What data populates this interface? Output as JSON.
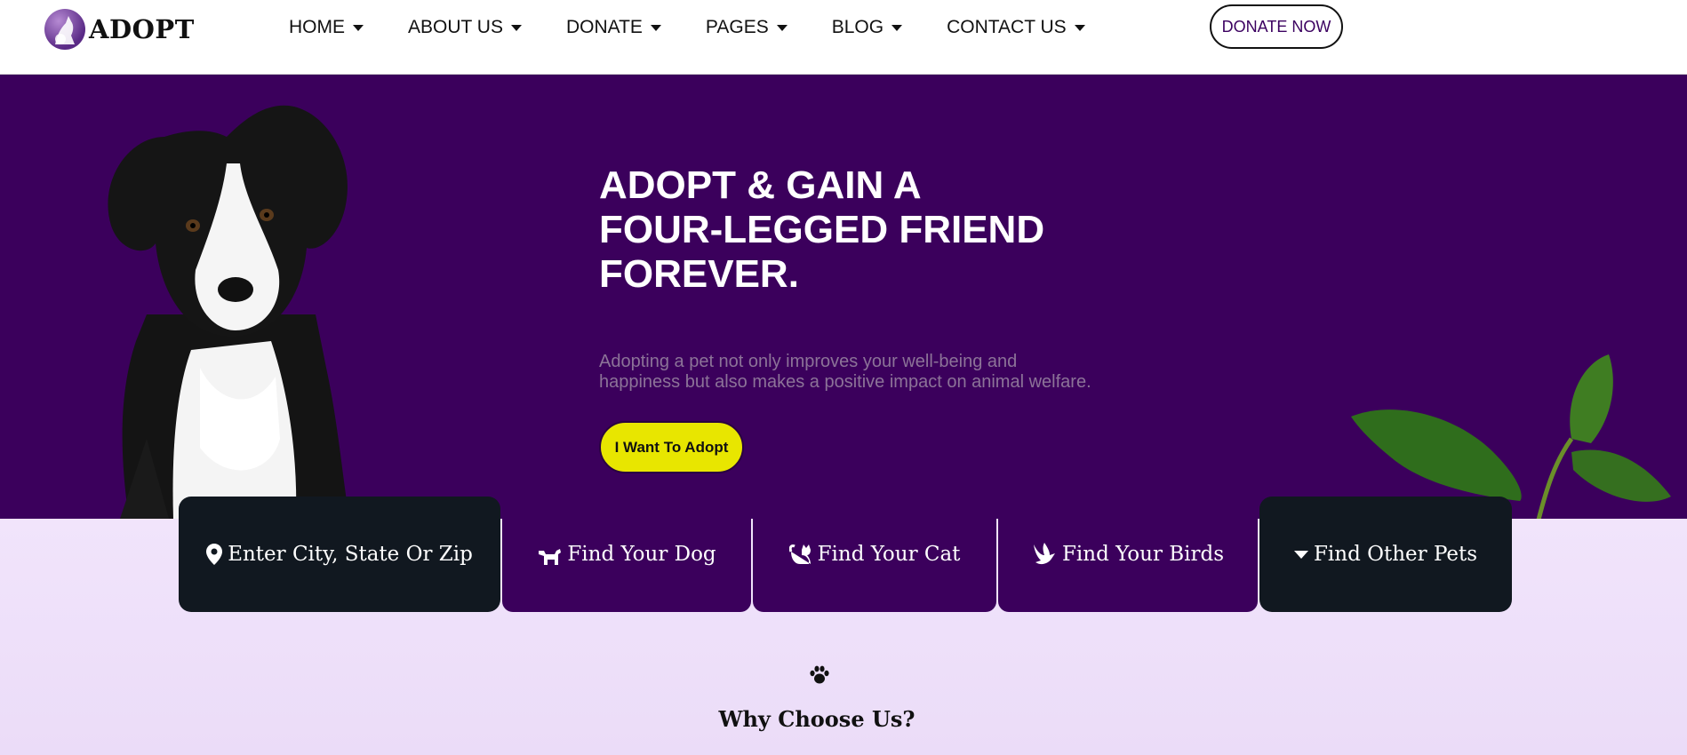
{
  "brand": {
    "name": "ADOPT"
  },
  "nav": {
    "items": [
      {
        "label": "HOME"
      },
      {
        "label": "ABOUT US"
      },
      {
        "label": "DONATE"
      },
      {
        "label": "PAGES"
      },
      {
        "label": "BLOG"
      },
      {
        "label": "CONTACT US"
      }
    ],
    "cta_label": "DONATE NOW"
  },
  "hero": {
    "title_lines": [
      "ADOPT & GAIN A",
      "FOUR-LEGGED FRIEND",
      "FOREVER."
    ],
    "subtitle_lines": [
      "Adopting a pet not only improves your well-being and",
      "happiness but also makes a positive impact on animal welfare."
    ],
    "button_label": "I Want To Adopt"
  },
  "search": {
    "location_label": "Enter City, State Or Zip",
    "dog_label": "Find Your Dog",
    "cat_label": "Find Your Cat",
    "birds_label": "Find Your Birds",
    "other_label": "Find Other Pets"
  },
  "section": {
    "title": "Why Choose Us?"
  },
  "colors": {
    "primary_purple": "#3b005c",
    "dark": "#111820",
    "accent_yellow": "#e8e600",
    "lavender": "#efe2fa"
  },
  "icons": {
    "dropdown": "caret-down-icon",
    "location": "map-pin-icon",
    "dog": "dog-icon",
    "cat": "cat-icon",
    "bird": "dove-icon",
    "other": "caret-down-icon",
    "paw": "paw-icon"
  }
}
